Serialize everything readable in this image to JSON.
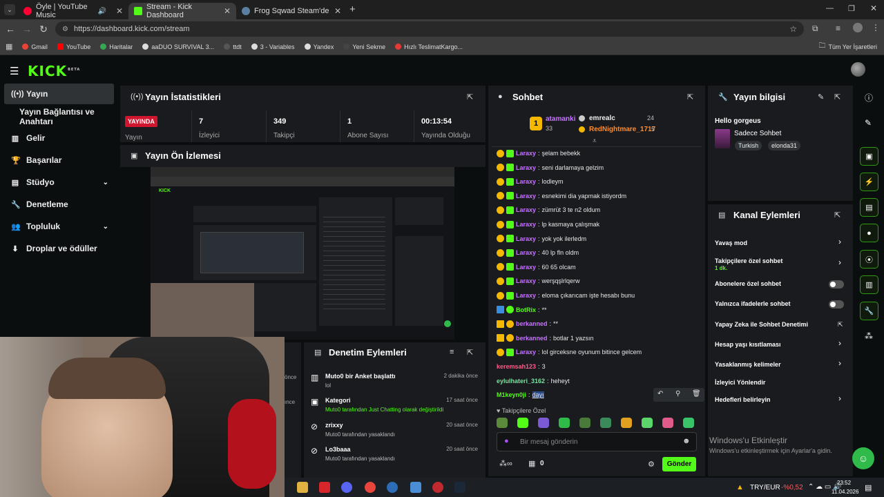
{
  "browser": {
    "tabs": [
      {
        "title": "Öyle | YouTube Music",
        "color": "#ff0033"
      },
      {
        "title": "Stream - Kick Dashboard",
        "color": "#53fc18"
      },
      {
        "title": "Frog Sqwad Steam'de",
        "color": "#1b2838"
      }
    ],
    "url": "https://dashboard.kick.com/stream",
    "bookmarks": [
      "Gmail",
      "YouTube",
      "Haritalar",
      "aaDUO SURVIVAL 3...",
      "ttdt",
      "3 - Variables",
      "Yandex",
      "Yeni Sekme",
      "Hızlı TeslimatKargo..."
    ],
    "all_bookmarks": "Tüm Yer İşaretleri"
  },
  "brand": {
    "logo": "KICK",
    "beta": "BETA",
    "accent": "#53fc18"
  },
  "sidebar": {
    "items": [
      {
        "label": "Yayın",
        "icon": "broadcast-icon"
      },
      {
        "label": "Yayın Bağlantısı ve Anahtarı",
        "icon": ""
      },
      {
        "label": "Gelir",
        "icon": "chart-icon"
      },
      {
        "label": "Başarılar",
        "icon": "trophy-icon"
      },
      {
        "label": "Stüdyo",
        "icon": "studio-icon"
      },
      {
        "label": "Denetleme",
        "icon": "wrench-icon"
      },
      {
        "label": "Topluluk",
        "icon": "community-icon"
      },
      {
        "label": "Droplar ve ödüller",
        "icon": "drops-icon"
      }
    ]
  },
  "stats": {
    "title": "Yayın İstatistikleri",
    "live_badge": "YAYINDA",
    "live_label": "Yayın",
    "viewers": {
      "value": "7",
      "label": "İzleyici"
    },
    "followers": {
      "value": "349",
      "label": "Takipçi"
    },
    "subs": {
      "value": "1",
      "label": "Abone Sayısı"
    },
    "uptime": {
      "value": "00:13:54",
      "label": "Yayında Olduğu"
    }
  },
  "preview": {
    "title": "Yayın Ön İzlemesi"
  },
  "moderation": {
    "title": "Denetim Eylemleri",
    "items": [
      {
        "title": "Muto0 bir Anket başlattı",
        "sub": "lol",
        "time": "2 dakika önce"
      },
      {
        "title": "Kategori",
        "sub": "Muto0 tarafından Just Chatting olarak değiştirildi",
        "time": "17 saat önce"
      },
      {
        "title": "zrixxy",
        "sub": "Muto0 tarafından yasaklandı",
        "time": "20 saat önce"
      },
      {
        "title": "Lo3baaa",
        "sub": "Muto0 tarafından yasaklandı",
        "time": "20 saat önce"
      }
    ],
    "left_time_a": "önce",
    "left_time_b": "ınce"
  },
  "chat": {
    "title": "Sohbet",
    "leaders": [
      {
        "rank": "1",
        "name": "atamanki",
        "count": "33"
      },
      {
        "name": "emrealc",
        "count": "24"
      },
      {
        "name": "RedNightmare_1717",
        "count": "5"
      }
    ],
    "messages": [
      {
        "nick": "Laraxy",
        "text": "şelam bebekk",
        "color": "#c774ff",
        "badges": [
          "sub",
          "gift"
        ]
      },
      {
        "nick": "Laraxy",
        "text": "seni darlamaya gelzim",
        "color": "#c774ff",
        "badges": [
          "sub",
          "gift"
        ]
      },
      {
        "nick": "Laraxy",
        "text": "lodleym",
        "color": "#c774ff",
        "badges": [
          "sub",
          "gift"
        ]
      },
      {
        "nick": "Laraxy",
        "text": "esnekimi dia yapmak istiyordm",
        "color": "#c774ff",
        "badges": [
          "sub",
          "gift"
        ]
      },
      {
        "nick": "Laraxy",
        "text": "zümrüt 3 te n2 oldum",
        "color": "#c774ff",
        "badges": [
          "sub",
          "gift"
        ]
      },
      {
        "nick": "Laraxy",
        "text": "lp kasmaya çalışmak",
        "color": "#c774ff",
        "badges": [
          "sub",
          "gift"
        ]
      },
      {
        "nick": "Laraxy",
        "text": "yok yok ilerledm",
        "color": "#c774ff",
        "badges": [
          "sub",
          "gift"
        ]
      },
      {
        "nick": "Laraxy",
        "text": "40 lp fln oldm",
        "color": "#c774ff",
        "badges": [
          "sub",
          "gift"
        ]
      },
      {
        "nick": "Laraxy",
        "text": "60 65 olcam",
        "color": "#c774ff",
        "badges": [
          "sub",
          "gift"
        ]
      },
      {
        "nick": "Laraxy",
        "text": "werşqşlrlqerw",
        "color": "#c774ff",
        "badges": [
          "sub",
          "gift"
        ]
      },
      {
        "nick": "Laraxy",
        "text": "eloma çıkarıcam işte hesabı bunu",
        "color": "#c774ff",
        "badges": [
          "sub",
          "gift"
        ]
      },
      {
        "nick": "BotRix",
        "text": "**",
        "color": "#53fc18",
        "badges": [
          "bot",
          "ver"
        ]
      },
      {
        "nick": "berkanned",
        "text": "**",
        "color": "#c774ff",
        "badges": [
          "crown",
          "sub"
        ]
      },
      {
        "nick": "berkanned",
        "text": "botlar 1 yazsın",
        "color": "#c774ff",
        "badges": [
          "crown",
          "sub"
        ]
      },
      {
        "nick": "Laraxy",
        "text": "lol girceksne oyunum bitince gelcem",
        "color": "#c774ff",
        "badges": [
          "sub",
          "gift"
        ]
      },
      {
        "nick": "keremsah123",
        "text": "3",
        "color": "#ff5a8a",
        "badges": []
      },
      {
        "nick": "eylulhateri_3162",
        "text": "heheyt",
        "color": "#7ee0a0",
        "badges": []
      },
      {
        "nick": "M1keyn0ji",
        "text": "dayı",
        "color": "#53fc18",
        "badges": []
      }
    ],
    "followers_only": "Takipçilere Özel",
    "input_placeholder": "Bir mesaj gönderin",
    "points": "0",
    "send": "Gönder"
  },
  "stream_info": {
    "title": "Yayın bilgisi",
    "stream_title": "Hello gorgeus",
    "category": "Sadece Sohbet",
    "tags": [
      "Turkish",
      "elonda31"
    ]
  },
  "channel_actions": {
    "title": "Kanal Eylemleri",
    "items": [
      {
        "label": "Yavaş mod",
        "sub": "",
        "control": "chevron"
      },
      {
        "label": "Takipçilere özel sohbet",
        "sub": "1 dk.",
        "control": "chevron"
      },
      {
        "label": "Abonelere özel sohbet",
        "sub": "",
        "control": "toggle"
      },
      {
        "label": "Yalnızca ifadelerle sohbet",
        "sub": "",
        "control": "toggle"
      },
      {
        "label": "Yapay Zeka ile Sohbet Denetimi",
        "sub": "",
        "control": "external"
      },
      {
        "label": "Hesap yaşı kısıtlaması",
        "sub": "",
        "control": "chevron"
      },
      {
        "label": "Yasaklanmış kelimeler",
        "sub": "",
        "control": "chevron"
      },
      {
        "label": "İzleyici Yönlendir",
        "sub": "",
        "control": "none"
      },
      {
        "label": "Hedefleri belirleyin",
        "sub": "",
        "control": "chevron"
      }
    ]
  },
  "windows": {
    "activate_title": "Windows'u Etkinleştir",
    "activate_sub": "Windows'u etkinleştirmek için Ayarlar'a gidin.",
    "currency": "TRY/EUR",
    "change": "-%0,52",
    "time": "23:52",
    "date": "11.04.2026"
  }
}
